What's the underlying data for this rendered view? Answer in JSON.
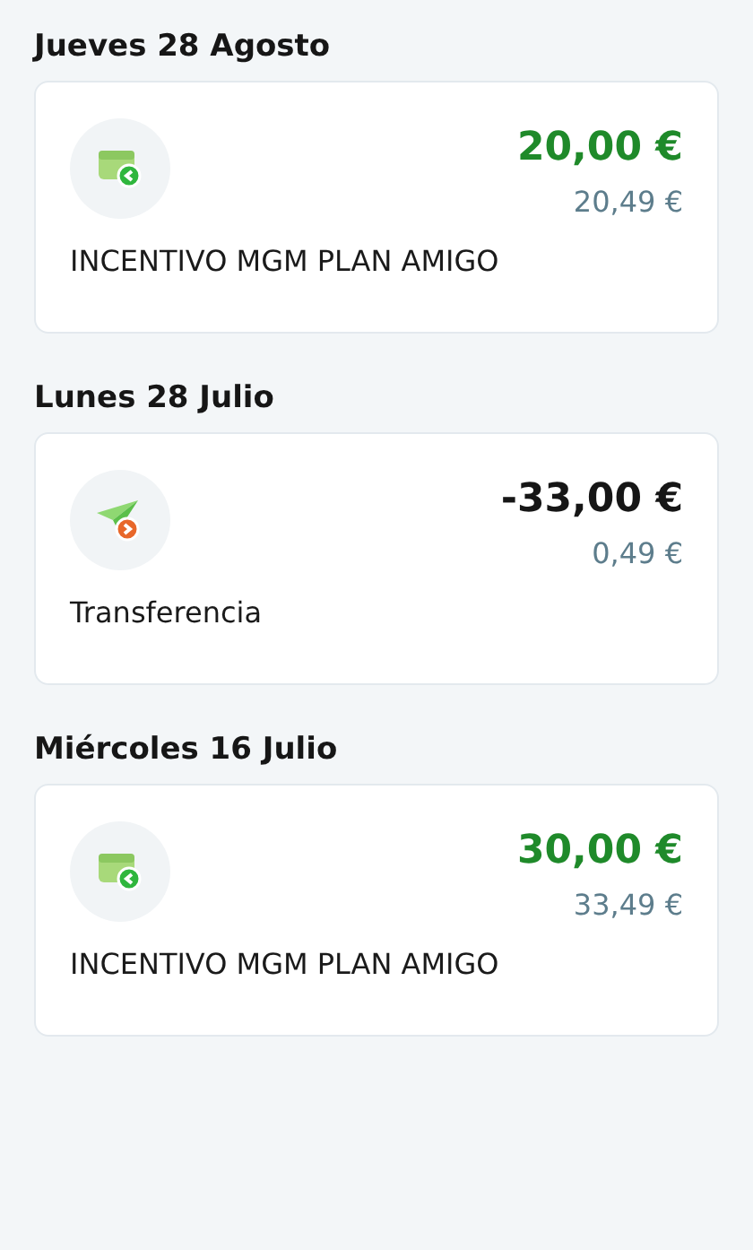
{
  "groups": [
    {
      "date": "Jueves 28 Agosto",
      "movement": {
        "kind": "income",
        "amount": "20,00 €",
        "balance": "20,49 €",
        "concept": "INCENTIVO MGM PLAN AMIGO"
      }
    },
    {
      "date": "Lunes 28 Julio",
      "movement": {
        "kind": "transfer",
        "amount": "-33,00 €",
        "balance": "0,49 €",
        "concept": "Transferencia"
      }
    },
    {
      "date": "Miércoles 16 Julio",
      "movement": {
        "kind": "income",
        "amount": "30,00 €",
        "balance": "33,49 €",
        "concept": "INCENTIVO MGM PLAN AMIGO"
      }
    }
  ]
}
